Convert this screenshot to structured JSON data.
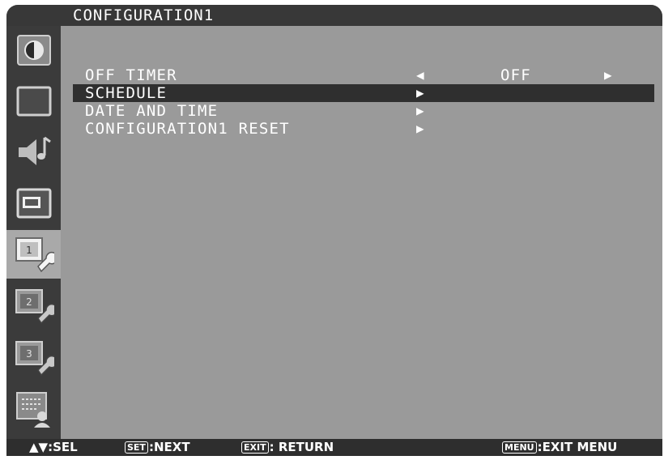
{
  "title": "CONFIGURATION1",
  "sidebar": {
    "items": [
      {
        "icon": "picture-contrast-icon",
        "active": false
      },
      {
        "icon": "screen-adjust-icon",
        "active": false
      },
      {
        "icon": "audio-icon",
        "active": false
      },
      {
        "icon": "pip-icon",
        "active": false
      },
      {
        "icon": "configuration1-icon",
        "badge": "1",
        "active": true
      },
      {
        "icon": "configuration2-icon",
        "badge": "2",
        "active": false
      },
      {
        "icon": "configuration3-icon",
        "badge": "3",
        "active": false
      },
      {
        "icon": "advanced-option-icon",
        "active": false
      }
    ]
  },
  "menu": {
    "rows": [
      {
        "label": "OFF TIMER",
        "left_arrow": "◀",
        "value": "OFF",
        "right_arrow": "▶",
        "selected": false
      },
      {
        "label": "SCHEDULE",
        "arrow": "▶",
        "selected": true
      },
      {
        "label": "DATE AND TIME",
        "arrow": "▶",
        "selected": false
      },
      {
        "label": "CONFIGURATION1 RESET",
        "arrow": "▶",
        "selected": false
      }
    ]
  },
  "footer": {
    "sel_arrows": "▲▼",
    "sel_text": ":SEL",
    "set_key": "SET",
    "set_text": ":NEXT",
    "exit_key": "EXIT",
    "exit_text": ": RETURN",
    "menu_key": "MENU",
    "menu_text": ":EXIT MENU"
  },
  "colors": {
    "background": "#9a9a9a",
    "bar": "#383838",
    "selected_row": "#2f2f2f",
    "text": "#ffffff"
  }
}
